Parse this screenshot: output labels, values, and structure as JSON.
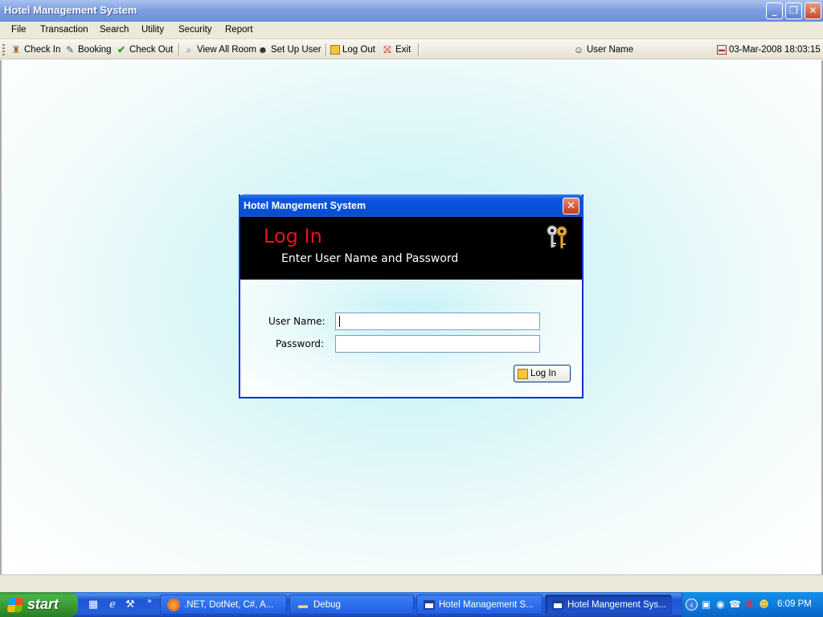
{
  "window": {
    "title": "Hotel Management System",
    "minimize": "_",
    "maximize": "❐",
    "close": "✕"
  },
  "menu": {
    "items": [
      "File",
      "Transaction",
      "Search",
      "Utility",
      "Security",
      "Report"
    ]
  },
  "toolbar": {
    "check_in": "Check In",
    "booking": "Booking",
    "check_out": "Check Out",
    "view_all_room": "View All Room",
    "set_up_user": "Set Up User",
    "log_out": "Log Out",
    "exit": "Exit",
    "user_name": "User Name",
    "datetime": "03-Mar-2008 18:03:15"
  },
  "dialog": {
    "title": "Hotel Mangement System",
    "heading": "Log In",
    "subheading": "Enter User Name and Password",
    "username_label": "User Name:",
    "password_label": "Password:",
    "username_value": "",
    "password_value": "",
    "login_button": "Log In",
    "close": "✕"
  },
  "taskbar": {
    "start": "start",
    "tasks": [
      ".NET, DotNet, C#, A...",
      "Debug",
      "Hotel Management S...",
      "Hotel Mangement Sys..."
    ],
    "clock": "6:09 PM"
  },
  "colors": {
    "accent_red": "#e8121c",
    "xp_blue": "#0b56e3",
    "xp_start_green": "#34932f"
  }
}
